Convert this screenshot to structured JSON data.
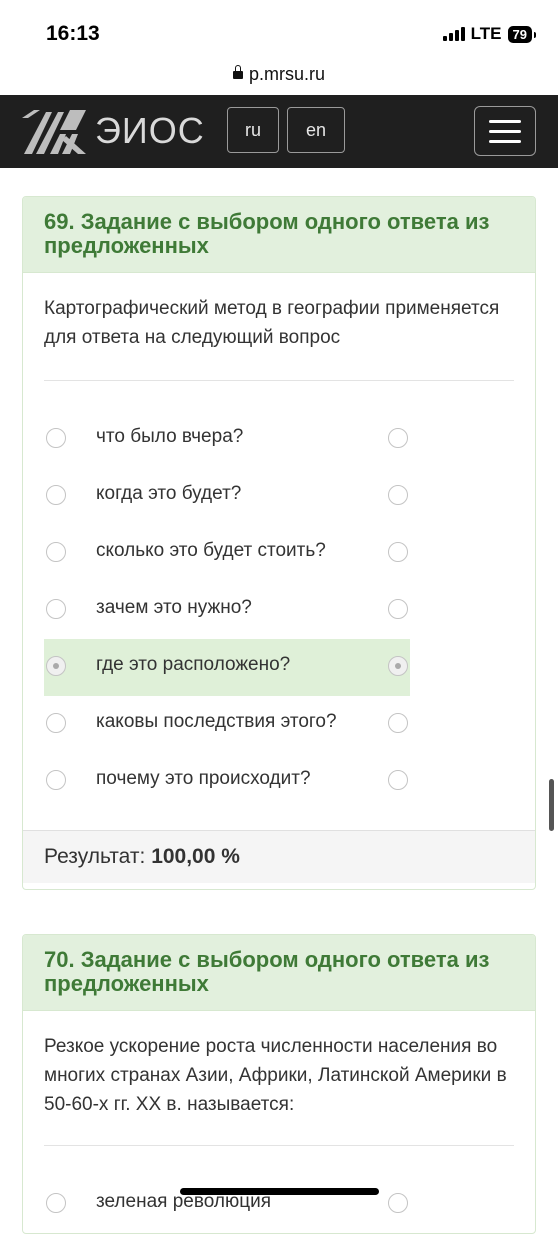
{
  "status_bar": {
    "time": "16:13",
    "network": "LTE",
    "battery": "79"
  },
  "browser": {
    "url": "p.mrsu.ru"
  },
  "navbar": {
    "logo_text": "ЭИОС",
    "lang_ru": "ru",
    "lang_en": "en",
    "bg_color": "#1f1f1f"
  },
  "cards": [
    {
      "title": "69. Задание с выбором одного ответа из предложенных",
      "question": "Картографический метод в географии применяется для ответа на следующий вопрос",
      "options": [
        {
          "label": "что было вчера?",
          "selected": false
        },
        {
          "label": "когда это будет?",
          "selected": false
        },
        {
          "label": "сколько это будет стоить?",
          "selected": false
        },
        {
          "label": "зачем это нужно?",
          "selected": false
        },
        {
          "label": "где это расположено?",
          "selected": true
        },
        {
          "label": "каковы последствия этого?",
          "selected": false
        },
        {
          "label": "почему это происходит?",
          "selected": false
        }
      ],
      "result_label": "Результат:",
      "result_value": "100,00 %"
    },
    {
      "title": "70. Задание с выбором одного ответа из предложенных",
      "question": "Резкое ускорение роста численности населения во многих странах Азии, Африки, Латинской Америки в 50-60-х гг. XX в. называется:",
      "options": [
        {
          "label": "зеленая революция",
          "selected": false
        }
      ]
    }
  ],
  "colors": {
    "card_header_bg": "#e2f0dd",
    "card_header_text": "#3f7a37",
    "selected_bg": "#dff0d8"
  }
}
